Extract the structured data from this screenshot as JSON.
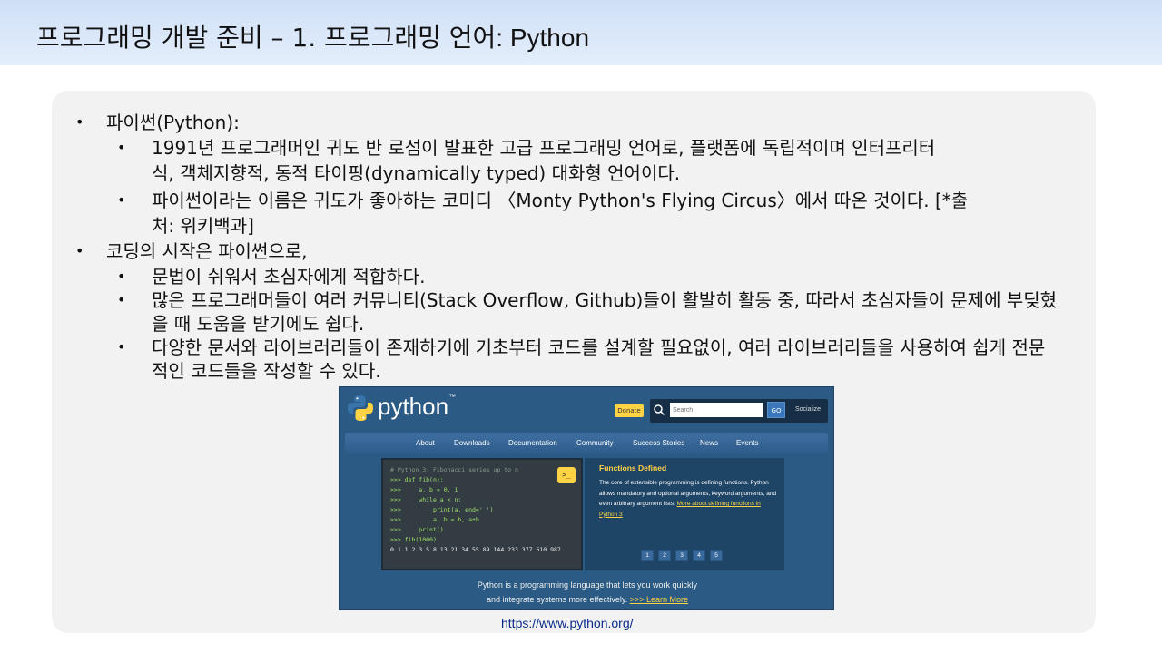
{
  "slide": {
    "title_main": "프로그래밍 개발 준비 – 1. 프로그래밍 언어",
    "title_sub": ": Python"
  },
  "bullets": {
    "b1": "파이썬(Python):",
    "b1_1a": "1991년 프로그래머인 귀도 반 로섬이 발표한 고급 프로그래밍 언어로, 플랫폼에 독립적이며 인터프리터",
    "b1_1b": "식, 객체지향적, 동적 타이핑(dynamically typed) 대화형 언어이다.",
    "b1_2a": "파이썬이라는 이름은 귀도가 좋아하는 코미디 〈Monty Python's Flying Circus〉에서 따온 것이다. [*출",
    "b1_2b": "처: 위키백과]",
    "b2": "코딩의 시작은 파이썬으로,",
    "b2_1": "문법이 쉬워서 초심자에게 적합하다.",
    "b2_2a": "많은 프로그래머들이 여러 커뮤니티(Stack Overflow, Github)들이 활발히 활동 중, 따라서 초심자들이 문제에 부딪혔",
    "b2_2b": "을 때 도움을 받기에도 쉽다.",
    "b2_3a": "다양한 문서와 라이브러리들이 존재하기에 기초부터 코드를 설계할 필요없이, 여러 라이브러리들을 사용하여 쉽게 전문",
    "b2_3b": "적인 코드들을 작성할 수 있다.",
    "dot": "•"
  },
  "pysite": {
    "logo_text": "python",
    "tm": "™",
    "donate": "Donate",
    "search_placeholder": "Search",
    "go": "GO",
    "socialize": "Socialize",
    "nav": [
      "About",
      "Downloads",
      "Documentation",
      "Community",
      "Success Stories",
      "News",
      "Events"
    ],
    "code": [
      "# Python 3: Fibonacci series up to n",
      ">>> def fib(n):",
      ">>>     a, b = 0, 1",
      ">>>     while a < n:",
      ">>>         print(a, end=' ')",
      ">>>         a, b = b, a+b",
      ">>>     print()",
      ">>> fib(1000)",
      "0 1 1 2 3 5 8 13 21 34 55 89 144 233 377 610 987"
    ],
    "terminal_btn": ">_",
    "feature_title": "Functions Defined",
    "feature_body": "The core of extensible programming is defining functions. Python allows mandatory and optional arguments, keyword arguments, and even arbitrary argument lists.",
    "feature_link": "More about defining functions in Python 3",
    "pages": [
      "1",
      "2",
      "3",
      "4",
      "5"
    ],
    "intro_line1": "Python is a programming language that lets you work quickly",
    "intro_line2": "and integrate systems more effectively.",
    "learn_more": ">>> Learn More"
  },
  "source_link": "https://www.python.org/"
}
